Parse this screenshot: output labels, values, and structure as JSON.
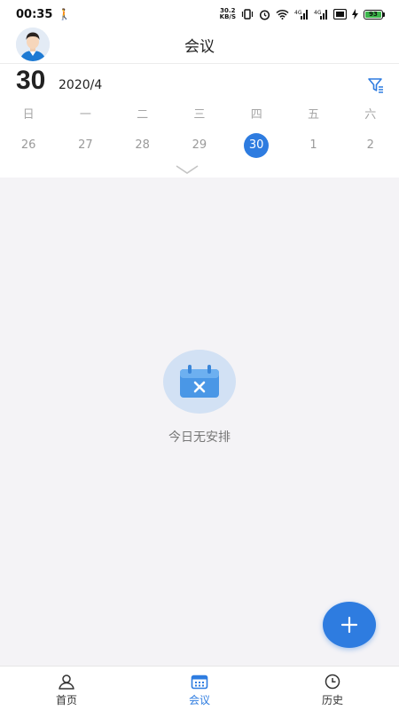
{
  "status": {
    "time": "00:35",
    "net_speed_value": "30.2",
    "net_speed_unit": "KB/S",
    "battery": "93"
  },
  "header": {
    "title": "会议"
  },
  "calendar": {
    "day": "30",
    "year_month": "2020/4",
    "weekdays": [
      "日",
      "一",
      "二",
      "三",
      "四",
      "五",
      "六"
    ],
    "dates": [
      "26",
      "27",
      "28",
      "29",
      "30",
      "1",
      "2"
    ],
    "selected_index": 4
  },
  "empty_state": {
    "message": "今日无安排"
  },
  "tabbar": {
    "tabs": [
      {
        "label": "首页",
        "icon": "home-person-icon"
      },
      {
        "label": "会议",
        "icon": "calendar-icon"
      },
      {
        "label": "历史",
        "icon": "clock-icon"
      }
    ],
    "active_index": 1
  },
  "colors": {
    "accent": "#2e7ce0",
    "empty_circle": "#d2e1f4",
    "background": "#f4f3f6"
  }
}
